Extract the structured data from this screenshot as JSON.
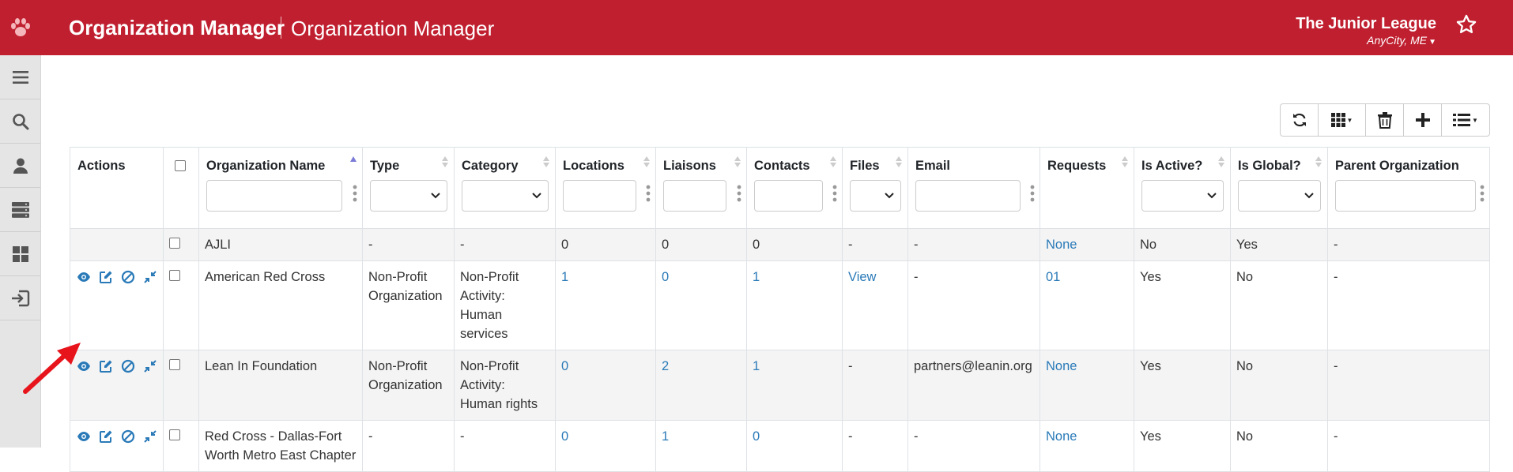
{
  "header": {
    "app_title": "Organization Manager",
    "page_title": "Organization Manager",
    "org_name": "The Junior League",
    "org_city": "AnyCity, ME"
  },
  "sidebar": {
    "items": [
      {
        "icon": "menu-icon"
      },
      {
        "icon": "search-icon"
      },
      {
        "icon": "user-icon"
      },
      {
        "icon": "server-icon"
      },
      {
        "icon": "dashboard-icon"
      },
      {
        "icon": "logout-icon"
      }
    ]
  },
  "toolbar": {
    "buttons": [
      "refresh-icon",
      "columns-icon",
      "trash-icon",
      "add-icon",
      "list-icon"
    ]
  },
  "table": {
    "columns": {
      "actions": "Actions",
      "org_name": "Organization Name",
      "type": "Type",
      "category": "Category",
      "locations": "Locations",
      "liaisons": "Liaisons",
      "contacts": "Contacts",
      "files": "Files",
      "email": "Email",
      "requests": "Requests",
      "is_active": "Is Active?",
      "is_global": "Is Global?",
      "parent": "Parent Organization"
    },
    "rows": [
      {
        "name": "AJLI",
        "type": "-",
        "category": "-",
        "locations": "0",
        "liaisons": "0",
        "contacts": "0",
        "files": "-",
        "email": "-",
        "requests": "None",
        "is_active": "No",
        "is_global": "Yes",
        "parent": "-"
      },
      {
        "name": "American Red Cross",
        "type": "Non-Profit Organization",
        "category": "Non-Profit Activity: Human services",
        "locations": "1",
        "liaisons": "0",
        "contacts": "1",
        "files": "View",
        "email": "-",
        "requests": "01",
        "is_active": "Yes",
        "is_global": "No",
        "parent": "-"
      },
      {
        "name": "Lean In Foundation",
        "type": "Non-Profit Organization",
        "category": "Non-Profit Activity: Human rights",
        "locations": "0",
        "liaisons": "2",
        "contacts": "1",
        "files": "-",
        "email": "partners@leanin.org",
        "requests": "None",
        "is_active": "Yes",
        "is_global": "No",
        "parent": "-"
      },
      {
        "name": "Red Cross - Dallas-Fort Worth Metro East Chapter",
        "type": "-",
        "category": "-",
        "locations": "0",
        "liaisons": "1",
        "contacts": "0",
        "files": "-",
        "email": "-",
        "requests": "None",
        "is_active": "Yes",
        "is_global": "No",
        "parent": "-"
      }
    ]
  },
  "colors": {
    "header_bg": "#c01f2f",
    "link": "#2a7ab8",
    "sidebar_bg": "#e5e5e5",
    "annotation_arrow": "#e8141c"
  }
}
